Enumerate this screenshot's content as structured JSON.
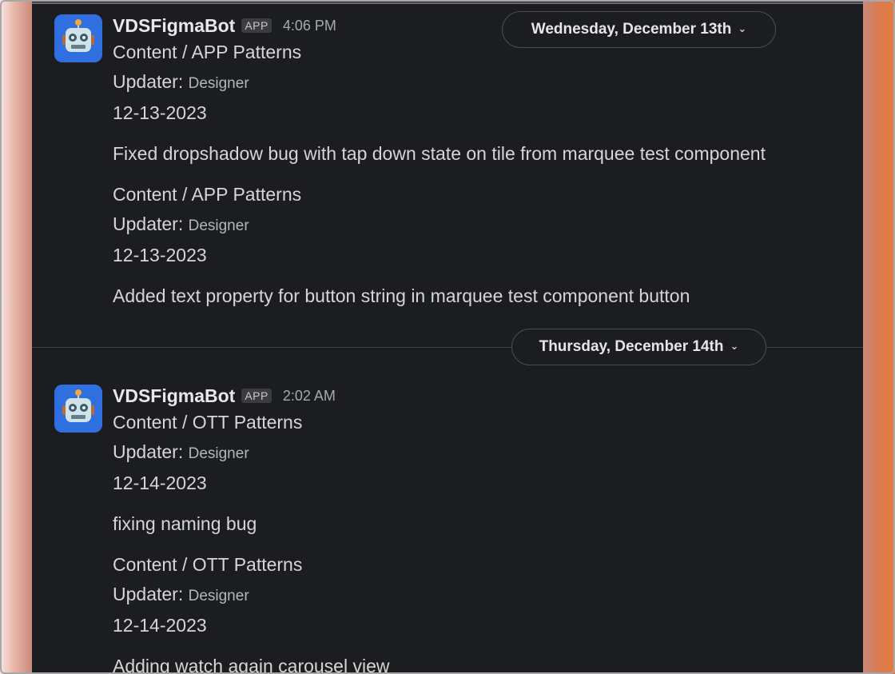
{
  "messages": [
    {
      "bot_name": "VDSFigmaBot",
      "badge": "APP",
      "time": "4:06 PM",
      "entries": [
        {
          "path": "Content / APP Patterns",
          "updater_label": "Updater:",
          "updater": "Designer",
          "date": "12-13-2023",
          "note": "Fixed dropshadow bug with tap down state on tile from marquee test component"
        },
        {
          "path": "Content / APP Patterns",
          "updater_label": "Updater:",
          "updater": "Designer",
          "date": "12-13-2023",
          "note": "Added text property for button string in marquee test component button"
        }
      ]
    },
    {
      "bot_name": "VDSFigmaBot",
      "badge": "APP",
      "time": "2:02 AM",
      "entries": [
        {
          "path": "Content / OTT Patterns",
          "updater_label": "Updater:",
          "updater": "Designer",
          "date": "12-14-2023",
          "note": "fixing naming bug"
        },
        {
          "path": "Content / OTT Patterns",
          "updater_label": "Updater:",
          "updater": "Designer",
          "date": "12-14-2023",
          "note": "Adding watch again carousel view"
        }
      ]
    }
  ],
  "date_dividers": {
    "first": {
      "label": "Wednesday, December 13th",
      "icon": "chevron-down-icon"
    },
    "second": {
      "label": "Thursday, December 14th",
      "icon": "chevron-down-icon"
    }
  },
  "colors": {
    "panel_bg": "#1b1d21",
    "avatar_bg": "#2f6fe0",
    "text": "#d6d6d6"
  }
}
